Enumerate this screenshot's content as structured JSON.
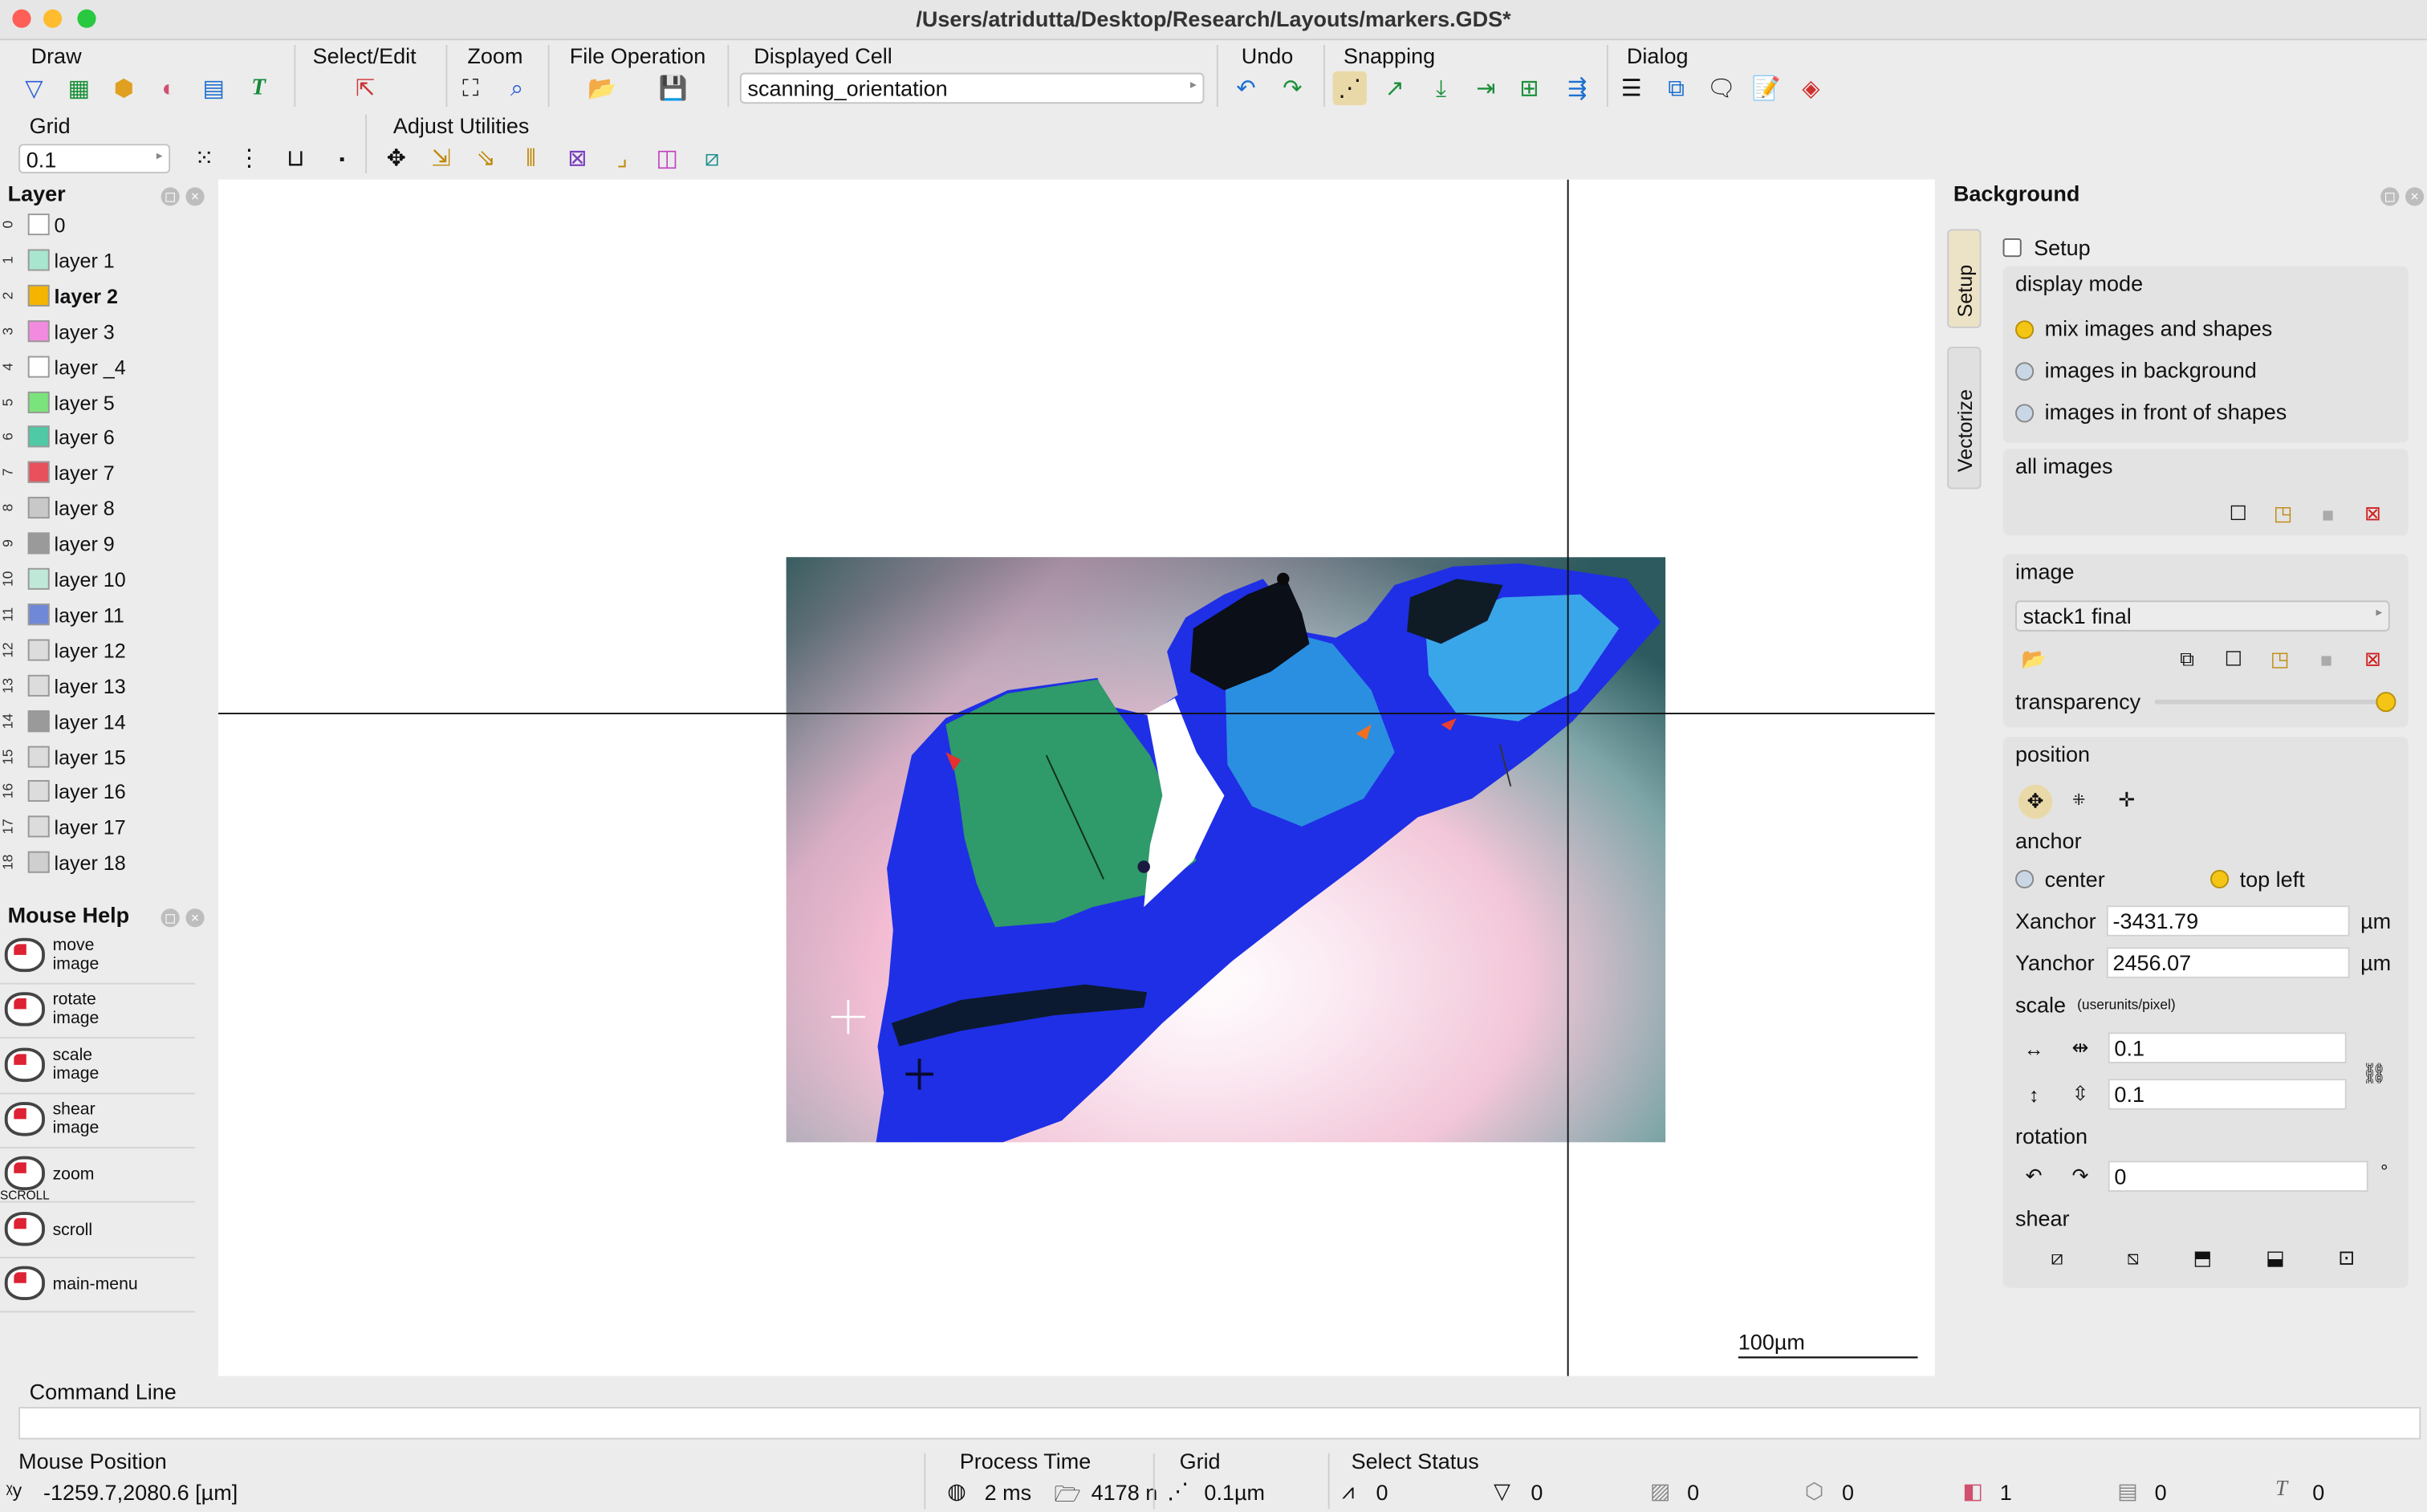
{
  "window": {
    "title": "/Users/atridutta/Desktop/Research/Layouts/markers.GDS*"
  },
  "toolbar": {
    "draw_label": "Draw",
    "select_edit_label": "Select/Edit",
    "zoom_label": "Zoom",
    "file_operation_label": "File Operation",
    "displayed_cell_label": "Displayed Cell",
    "displayed_cell_value": "scanning_orientation",
    "undo_label": "Undo",
    "snapping_label": "Snapping",
    "dialog_label": "Dialog",
    "grid_label": "Grid",
    "grid_value": "0.1",
    "adjust_utilities_label": "Adjust Utilities"
  },
  "layer_panel": {
    "title": "Layer",
    "layers": [
      {
        "num": "0",
        "label": "0",
        "color": "#ffffff"
      },
      {
        "num": "1",
        "label": "layer 1",
        "color": "#a8e6cf"
      },
      {
        "num": "2",
        "label": "layer 2",
        "color": "#f4b400"
      },
      {
        "num": "3",
        "label": "layer 3",
        "color": "#f28be0"
      },
      {
        "num": "4",
        "label": "layer _4",
        "color": "#ffffff"
      },
      {
        "num": "5",
        "label": "layer 5",
        "color": "#7be37b"
      },
      {
        "num": "6",
        "label": "layer 6",
        "color": "#4fc9a6"
      },
      {
        "num": "7",
        "label": "layer 7",
        "color": "#e8505b"
      },
      {
        "num": "8",
        "label": "layer 8",
        "color": "#c8c8c8"
      },
      {
        "num": "9",
        "label": "layer 9",
        "color": "#9a9a9a"
      },
      {
        "num": "10",
        "label": "layer 10",
        "color": "#bfe8d8"
      },
      {
        "num": "11",
        "label": "layer 11",
        "color": "#6f88d8"
      },
      {
        "num": "12",
        "label": "layer 12",
        "color": "#dcdcdc"
      },
      {
        "num": "13",
        "label": "layer 13",
        "color": "#dcdcdc"
      },
      {
        "num": "14",
        "label": "layer 14",
        "color": "#9a9a9a"
      },
      {
        "num": "15",
        "label": "layer 15",
        "color": "#dcdcdc"
      },
      {
        "num": "16",
        "label": "layer 16",
        "color": "#dcdcdc"
      },
      {
        "num": "17",
        "label": "layer 17",
        "color": "#dcdcdc"
      },
      {
        "num": "18",
        "label": "layer 18",
        "color": "#cfcfcf"
      }
    ]
  },
  "mouse_help": {
    "title": "Mouse Help",
    "items": [
      {
        "label": "move\nimage"
      },
      {
        "label": "rotate\nimage"
      },
      {
        "label": "scale\nimage"
      },
      {
        "label": "shear\nimage"
      },
      {
        "label": "zoom",
        "extra": "SCROLL"
      },
      {
        "label": "scroll"
      },
      {
        "label": "main-menu"
      }
    ]
  },
  "canvas": {
    "scale_bar_label": "100µm"
  },
  "background_panel": {
    "title": "Background",
    "tabs": [
      "Setup",
      "Vectorize"
    ],
    "setup_checkbox_label": "Setup",
    "display_mode": {
      "title": "display mode",
      "options": [
        "mix images and shapes",
        "images in background",
        "images in front of shapes"
      ],
      "selected": 0
    },
    "all_images_label": "all images",
    "image": {
      "title": "image",
      "selected": "stack1 final",
      "transparency_label": "transparency",
      "transparency_value": 1.0
    },
    "position": {
      "title": "position",
      "anchor_label": "anchor",
      "anchor_options": [
        "center",
        "top left"
      ],
      "anchor_selected": 1,
      "xanchor_label": "Xanchor",
      "xanchor_value": "-3431.79",
      "yanchor_label": "Yanchor",
      "yanchor_value": "2456.07",
      "unit": "µm",
      "scale_label": "scale",
      "scale_units": "(userunits/pixel)",
      "scale_x": "0.1",
      "scale_y": "0.1",
      "rotation_label": "rotation",
      "rotation_value": "0",
      "rotation_unit": "°",
      "shear_label": "shear"
    }
  },
  "command_line": {
    "label": "Command Line",
    "value": ""
  },
  "status_bar": {
    "mouse_position_label": "Mouse Position",
    "mouse_position_value": "-1259.7,2080.6 [µm]",
    "process_time_label": "Process Time",
    "process_time_value": "2 ms",
    "memory_value": "4178 n",
    "grid_label": "Grid",
    "grid_value": "0.1µm",
    "select_status_label": "Select Status",
    "select_counts": [
      "0",
      "0",
      "0",
      "0",
      "1",
      "0",
      "0"
    ]
  },
  "icons": {
    "draw": [
      "polygon-icon",
      "box-icon",
      "circle-icon",
      "path-icon",
      "cell-ref-icon",
      "text-icon"
    ],
    "colors": {
      "accent": "#f4c514",
      "radio_off": "#c9d6e6",
      "canvas_bg": "#ffffff"
    }
  }
}
